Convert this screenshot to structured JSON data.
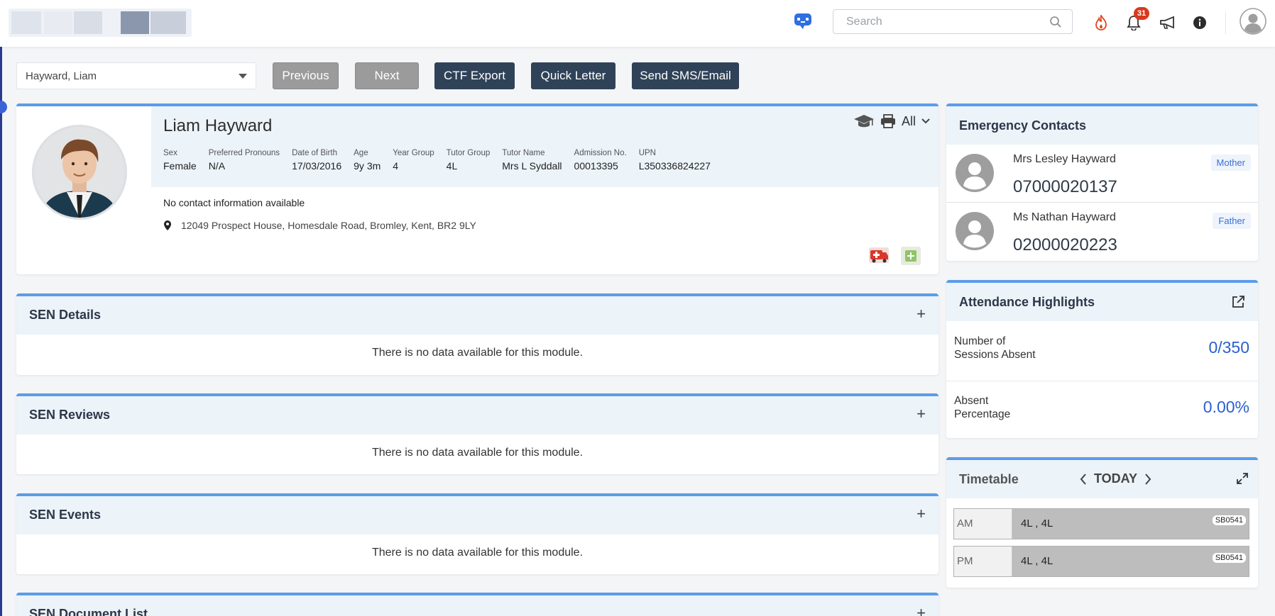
{
  "header": {
    "search_placeholder": "Search",
    "notification_count": "31"
  },
  "student_select": {
    "value": "Hayward, Liam"
  },
  "toolbar": {
    "previous": "Previous",
    "next": "Next",
    "ctf_export": "CTF Export",
    "quick_letter": "Quick Letter",
    "send_sms_email": "Send SMS/Email"
  },
  "profile": {
    "name": "Liam Hayward",
    "filter": "All",
    "fields": [
      {
        "label": "Sex",
        "value": "Female"
      },
      {
        "label": "Preferred Pronouns",
        "value": "N/A"
      },
      {
        "label": "Date of Birth",
        "value": "17/03/2016"
      },
      {
        "label": "Age",
        "value": "9y 3m"
      },
      {
        "label": "Year Group",
        "value": "4"
      },
      {
        "label": "Tutor Group",
        "value": "4L"
      },
      {
        "label": "Tutor Name",
        "value": "Mrs L Syddall"
      },
      {
        "label": "Admission No.",
        "value": "00013395"
      },
      {
        "label": "UPN",
        "value": "L350336824227"
      }
    ],
    "contact_info": "No contact information available",
    "address": "12049 Prospect House, Homesdale Road, Bromley, Kent, BR2 9LY"
  },
  "modules": [
    {
      "title": "SEN Details",
      "empty": "There is no data available for this module."
    },
    {
      "title": "SEN Reviews",
      "empty": "There is no data available for this module."
    },
    {
      "title": "SEN Events",
      "empty": "There is no data available for this module."
    },
    {
      "title": "SEN Document List"
    }
  ],
  "emergency": {
    "title": "Emergency Contacts",
    "contacts": [
      {
        "name": "Mrs Lesley Hayward",
        "phone": "07000020137",
        "relation": "Mother"
      },
      {
        "name": "Ms Nathan Hayward",
        "phone": "02000020223",
        "relation": "Father"
      }
    ]
  },
  "attendance": {
    "title": "Attendance Highlights",
    "sessions_label_1": "Number of",
    "sessions_label_2": "Sessions Absent",
    "sessions_value": "0/350",
    "percent_label_1": "Absent",
    "percent_label_2": "Percentage",
    "percent_value": "0.00%"
  },
  "timetable": {
    "title": "Timetable",
    "nav_label": "TODAY",
    "rows": [
      {
        "period": "AM",
        "classes": "4L , 4L",
        "room": "SB0541"
      },
      {
        "period": "PM",
        "classes": "4L , 4L",
        "room": "SB0541"
      }
    ]
  },
  "colors": {
    "accent_border": "#5b9ce8",
    "dark_button": "#2f4258",
    "grey_button": "#9b9b9b",
    "value_blue": "#2b5fce",
    "badge_red": "#d9381e"
  }
}
